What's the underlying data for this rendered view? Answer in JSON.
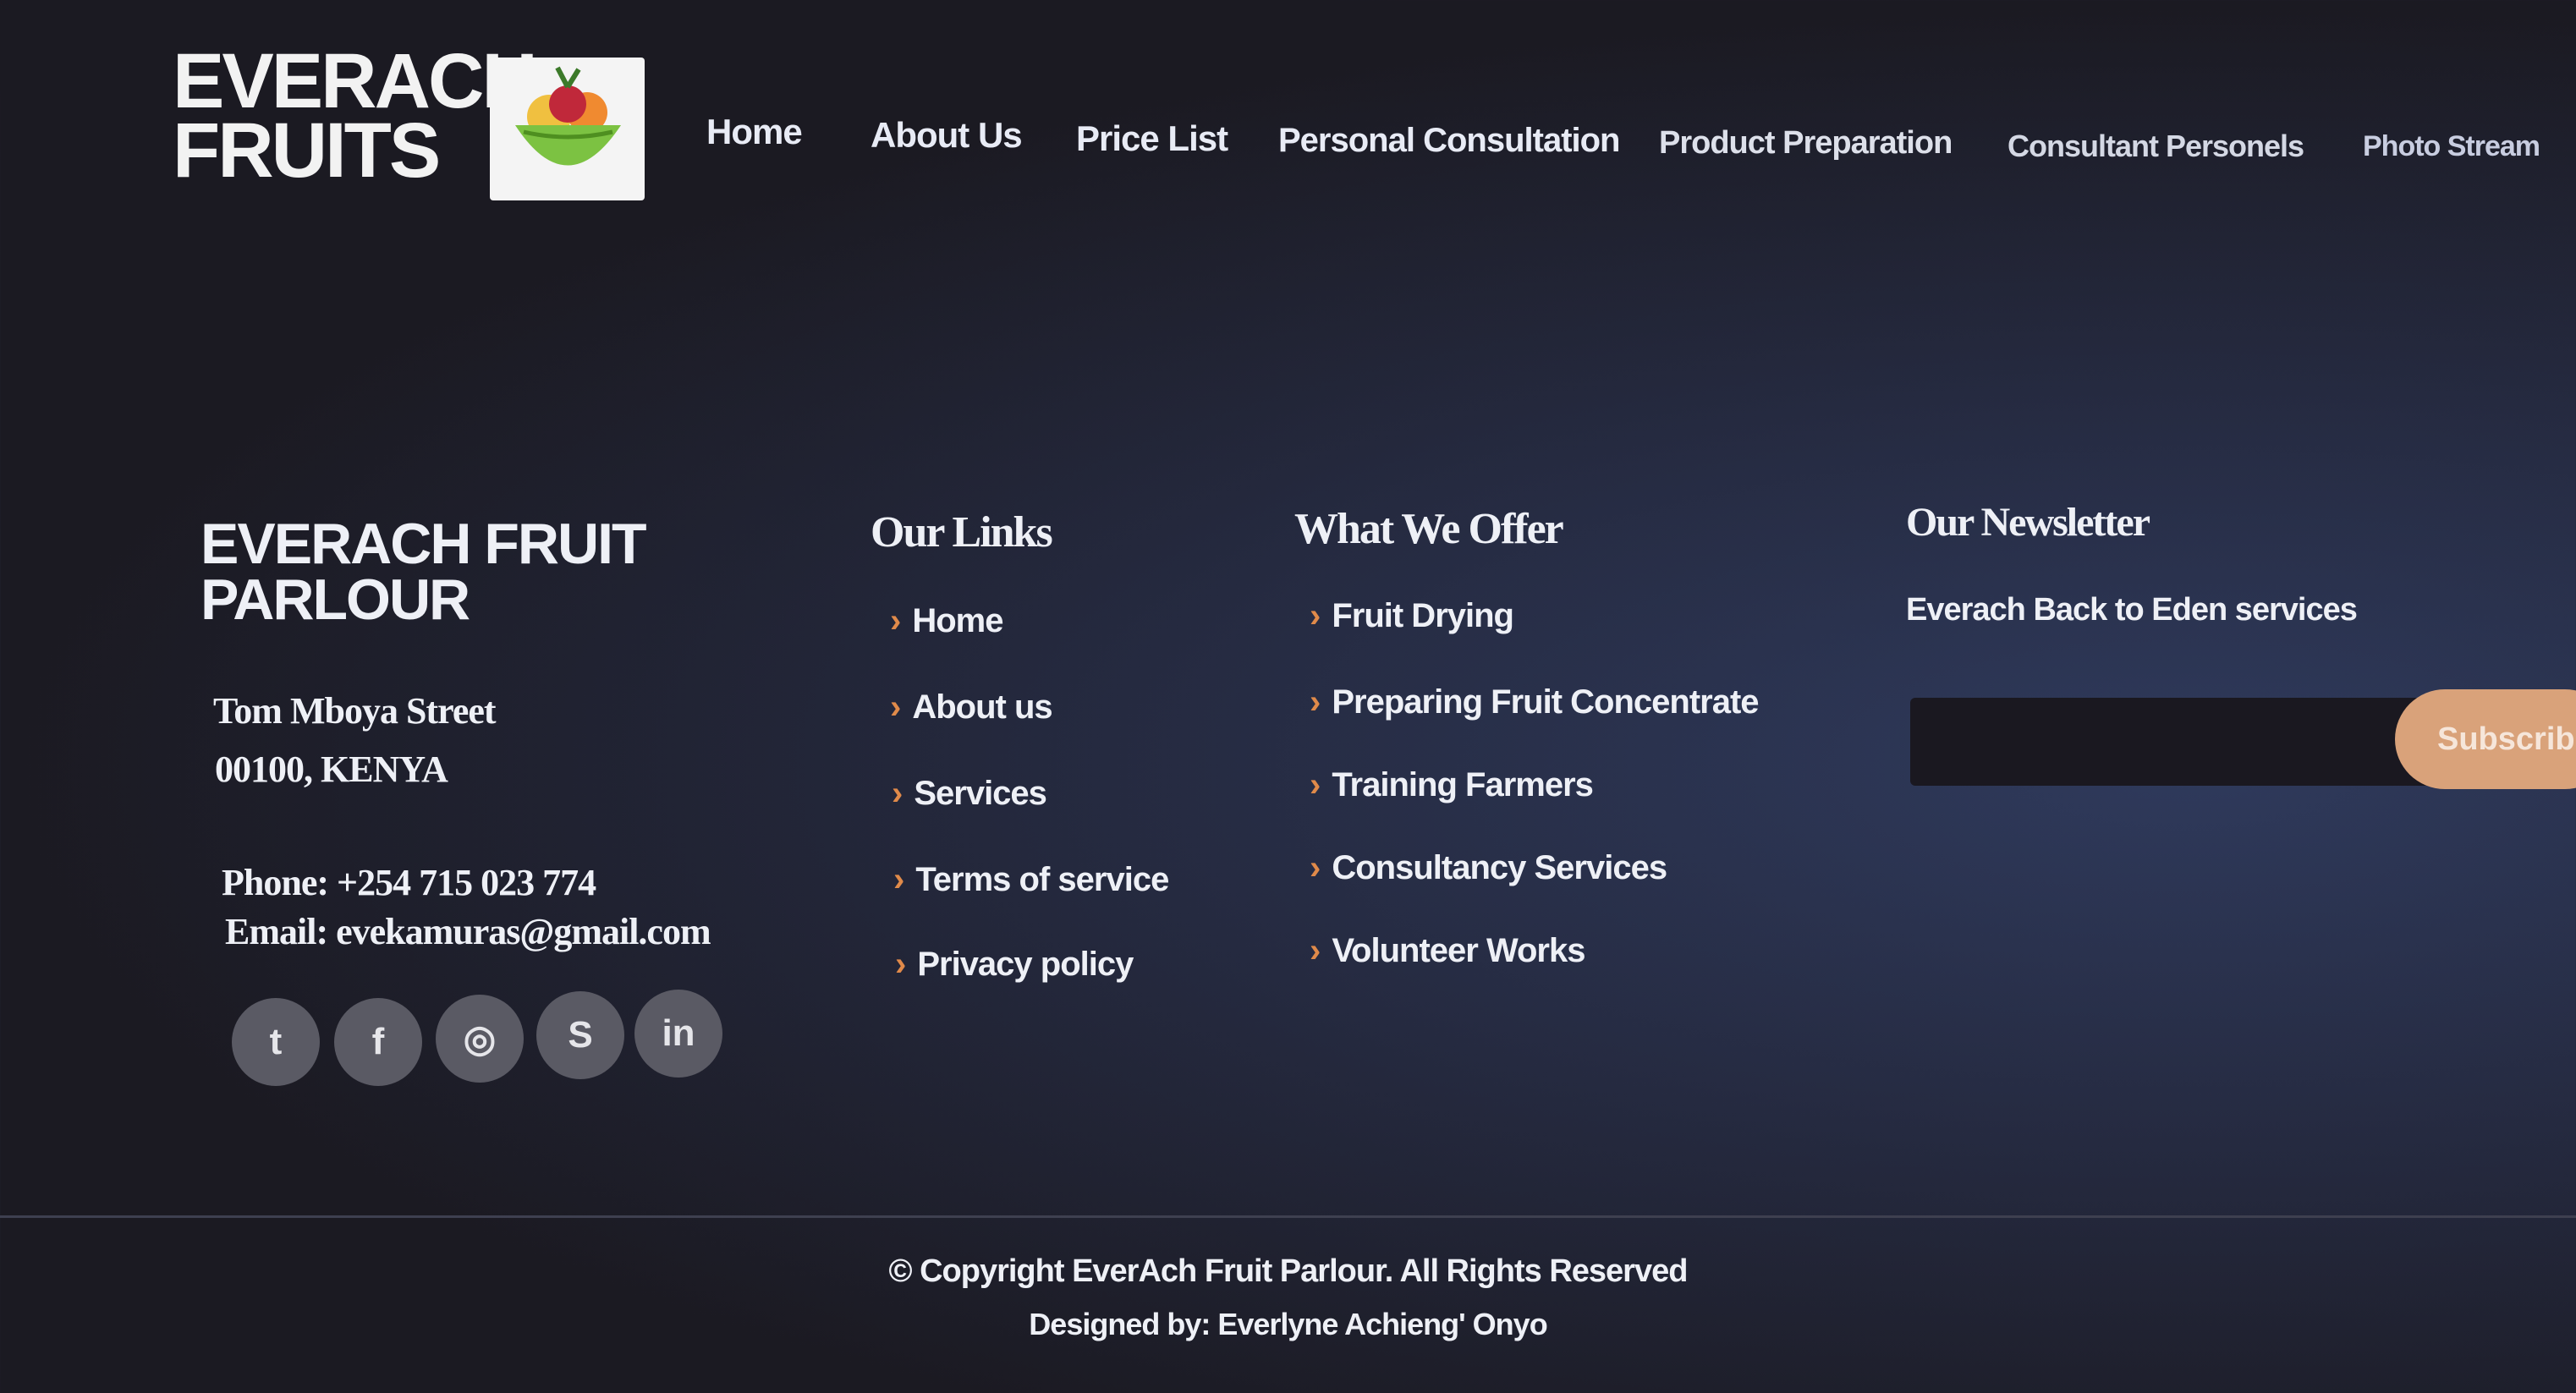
{
  "header": {
    "logo_line1": "EVERACH",
    "logo_line2": "FRUITS",
    "nav": [
      "Home",
      "About Us",
      "Price List",
      "Personal Consultation",
      "Product Preparation",
      "Consultant Personels",
      "Photo Stream"
    ]
  },
  "footer": {
    "brand": "EVERACH FRUIT PARLOUR",
    "address_line1": "Tom Mboya Street",
    "address_line2": "00100, KENYA",
    "phone": "Phone: +254 715 023 774",
    "email": "Email: evekamuras@gmail.com",
    "social": [
      {
        "icon": "twitter-icon",
        "glyph": "t"
      },
      {
        "icon": "facebook-icon",
        "glyph": "f"
      },
      {
        "icon": "instagram-icon",
        "glyph": "◎"
      },
      {
        "icon": "skype-icon",
        "glyph": "S"
      },
      {
        "icon": "linkedin-icon",
        "glyph": "in"
      }
    ],
    "links_heading": "Our Links",
    "links": [
      "Home",
      "About us",
      "Services",
      "Terms of service",
      "Privacy policy"
    ],
    "offer_heading": "What We Offer",
    "offers": [
      "Fruit Drying",
      "Preparing Fruit Concentrate",
      "Training Farmers",
      "Consultancy Services",
      "Volunteer Works"
    ],
    "newsletter_heading": "Our Newsletter",
    "newsletter_text": "Everach Back to Eden services",
    "subscribe_label": "Subscribe",
    "chevron": "›",
    "copyright": "© Copyright EverAch Fruit Parlour. All Rights Reserved",
    "designed_by": "Designed by: Everlyne Achieng' Onyo"
  },
  "colors": {
    "accent": "#d9a27a",
    "chevron": "#e08a4a"
  }
}
